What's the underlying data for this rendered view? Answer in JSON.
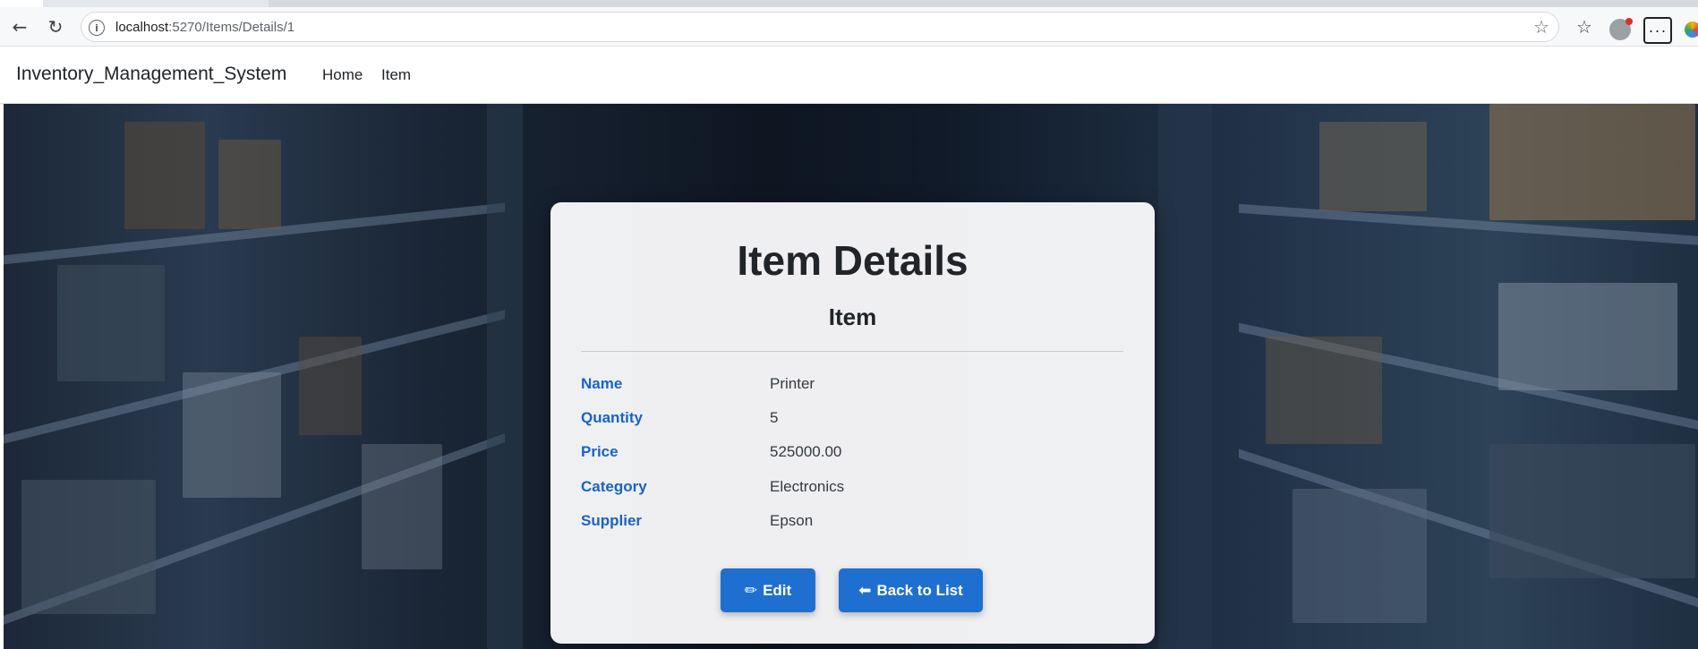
{
  "browser": {
    "url_host": "localhost",
    "url_path": ":5270/Items/Details/1"
  },
  "navbar": {
    "brand": "Inventory_Management_System",
    "links": [
      "Home",
      "Item"
    ]
  },
  "card": {
    "title": "Item Details",
    "subtitle": "Item",
    "fields": [
      {
        "label": "Name",
        "value": "Printer"
      },
      {
        "label": "Quantity",
        "value": "5"
      },
      {
        "label": "Price",
        "value": "525000.00"
      },
      {
        "label": "Category",
        "value": "Electronics"
      },
      {
        "label": "Supplier",
        "value": "Epson"
      }
    ],
    "edit_label": "Edit",
    "back_label": "Back to List"
  },
  "icons": {
    "edit": "pencil-icon",
    "back": "arrow-left-icon"
  },
  "colors": {
    "accent": "#1f6fd1",
    "label": "#1a63c2"
  }
}
